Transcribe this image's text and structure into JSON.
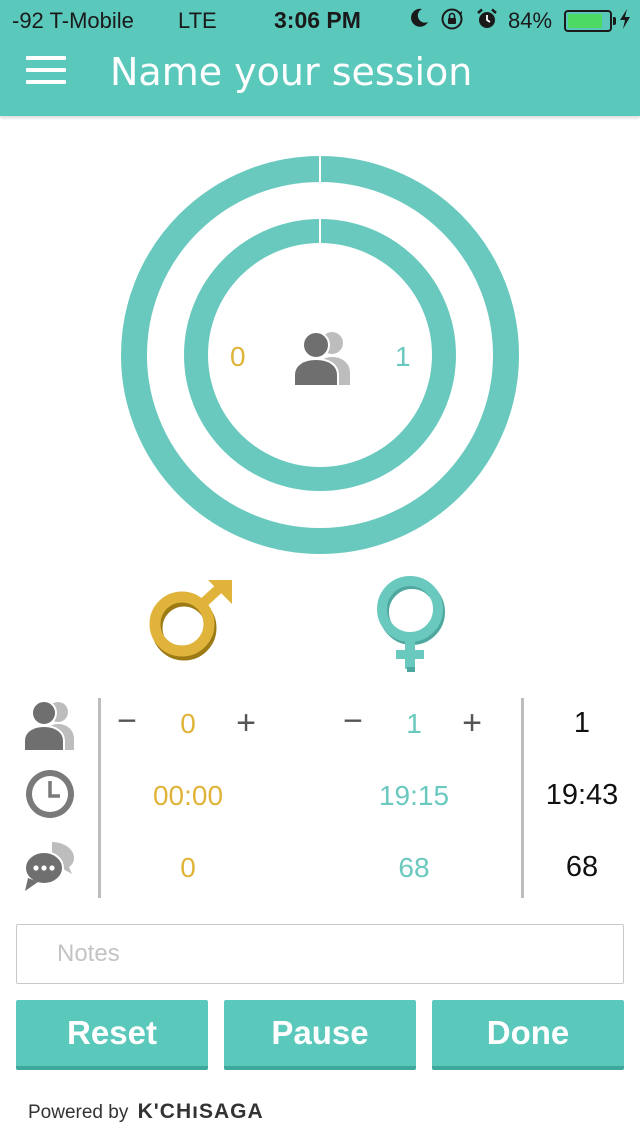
{
  "status_bar": {
    "carrier": "-92 T-Mobile",
    "network": "LTE",
    "time": "3:06 PM",
    "battery_percent": "84%",
    "battery_level": 0.84,
    "battery_color": "#4cd964"
  },
  "header": {
    "title": "Name your session",
    "menu_icon": "hamburger-icon",
    "color": "#5bc8bc"
  },
  "rings": {
    "left_count": "0",
    "right_count": "1",
    "center_icon": "people-icon",
    "ring_color": "#6ac9bf"
  },
  "genders": {
    "male_icon": "male-symbol-icon",
    "female_icon": "female-symbol-icon",
    "male_color": "#e0b43a",
    "female_color": "#6ac9bf"
  },
  "stats": {
    "participants": {
      "icon": "people-icon",
      "minus_label": "−",
      "plus_label": "+",
      "male": "0",
      "female": "1",
      "total": "1"
    },
    "time": {
      "icon": "clock-icon",
      "male": "00:00",
      "female": "19:15",
      "total": "19:43"
    },
    "turns": {
      "icon": "chat-icon",
      "male": "0",
      "female": "68",
      "total": "68"
    }
  },
  "notes": {
    "placeholder": "Notes",
    "value": ""
  },
  "buttons": {
    "reset": "Reset",
    "pause": "Pause",
    "done": "Done"
  },
  "footer": {
    "powered_by": "Powered by",
    "brand": "K'CHıSAGA"
  }
}
